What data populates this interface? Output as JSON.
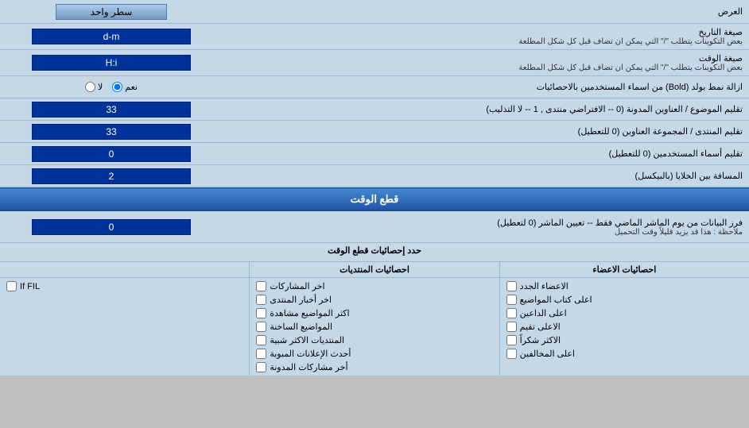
{
  "header": {
    "label": "العرض",
    "dropdown_label": "سطر واحد"
  },
  "rows": [
    {
      "id": "date_format",
      "label": "صيغة التاريخ",
      "sublabel": "بعض التكوينات يتطلب \"/\" التي يمكن ان تضاف قبل كل شكل المطلعة",
      "value": "d-m",
      "type": "input"
    },
    {
      "id": "time_format",
      "label": "صيغة الوقت",
      "sublabel": "بعض التكوينات يتطلب \"/\" التي يمكن ان تضاف قبل كل شكل المطلعة",
      "value": "H:i",
      "type": "input"
    },
    {
      "id": "bold_remove",
      "label": "ازالة نمط بولد (Bold) من اسماء المستخدمين بالاحصائيات",
      "type": "radio",
      "options": [
        "نعم",
        "لا"
      ],
      "selected": "نعم"
    },
    {
      "id": "topic_titles",
      "label": "تقليم الموضوع / العناوين المدونة (0 -- الافتراضي منتدى , 1 -- لا التذليب)",
      "value": "33",
      "type": "input"
    },
    {
      "id": "forum_titles",
      "label": "تقليم المنتدى / المجموعة العناوين (0 للتعطيل)",
      "value": "33",
      "type": "input"
    },
    {
      "id": "user_names",
      "label": "تقليم أسماء المستخدمين (0 للتعطيل)",
      "value": "0",
      "type": "input"
    },
    {
      "id": "cell_spacing",
      "label": "المسافة بين الخلايا (بالبيكسل)",
      "value": "2",
      "type": "input"
    }
  ],
  "cutoff_section": {
    "header": "قطع الوقت",
    "row": {
      "label": "فرز البيانات من يوم الماشر الماضي فقط -- تعيين الماشر (0 لتعطيل)",
      "note": "ملاحظة : هذا قد يزيد قليلاً وقت التحميل",
      "value": "0"
    }
  },
  "stats_section": {
    "header": "حدد إحصائيات قطع الوقت",
    "col1_header": "احصائيات الاعضاء",
    "col2_header": "احصائيات المنتديات",
    "col3_header": "",
    "col1_items": [
      "الاعضاء الجدد",
      "اعلى كتاب المواضيع",
      "اعلى الداعين",
      "الاعلى تقيم",
      "الاكثر شكراً",
      "اعلى المخالفين"
    ],
    "col2_items": [
      "اخر المشاركات",
      "اخر أخبار المنتدى",
      "اكثر المواضيع مشاهدة",
      "المواضيع الساخنة",
      "المنتديات الاكثر شبية",
      "أحدث الإعلانات المبوبة",
      "أخر مشاركات المدونة"
    ],
    "col3_items": [
      "If FIL"
    ]
  }
}
